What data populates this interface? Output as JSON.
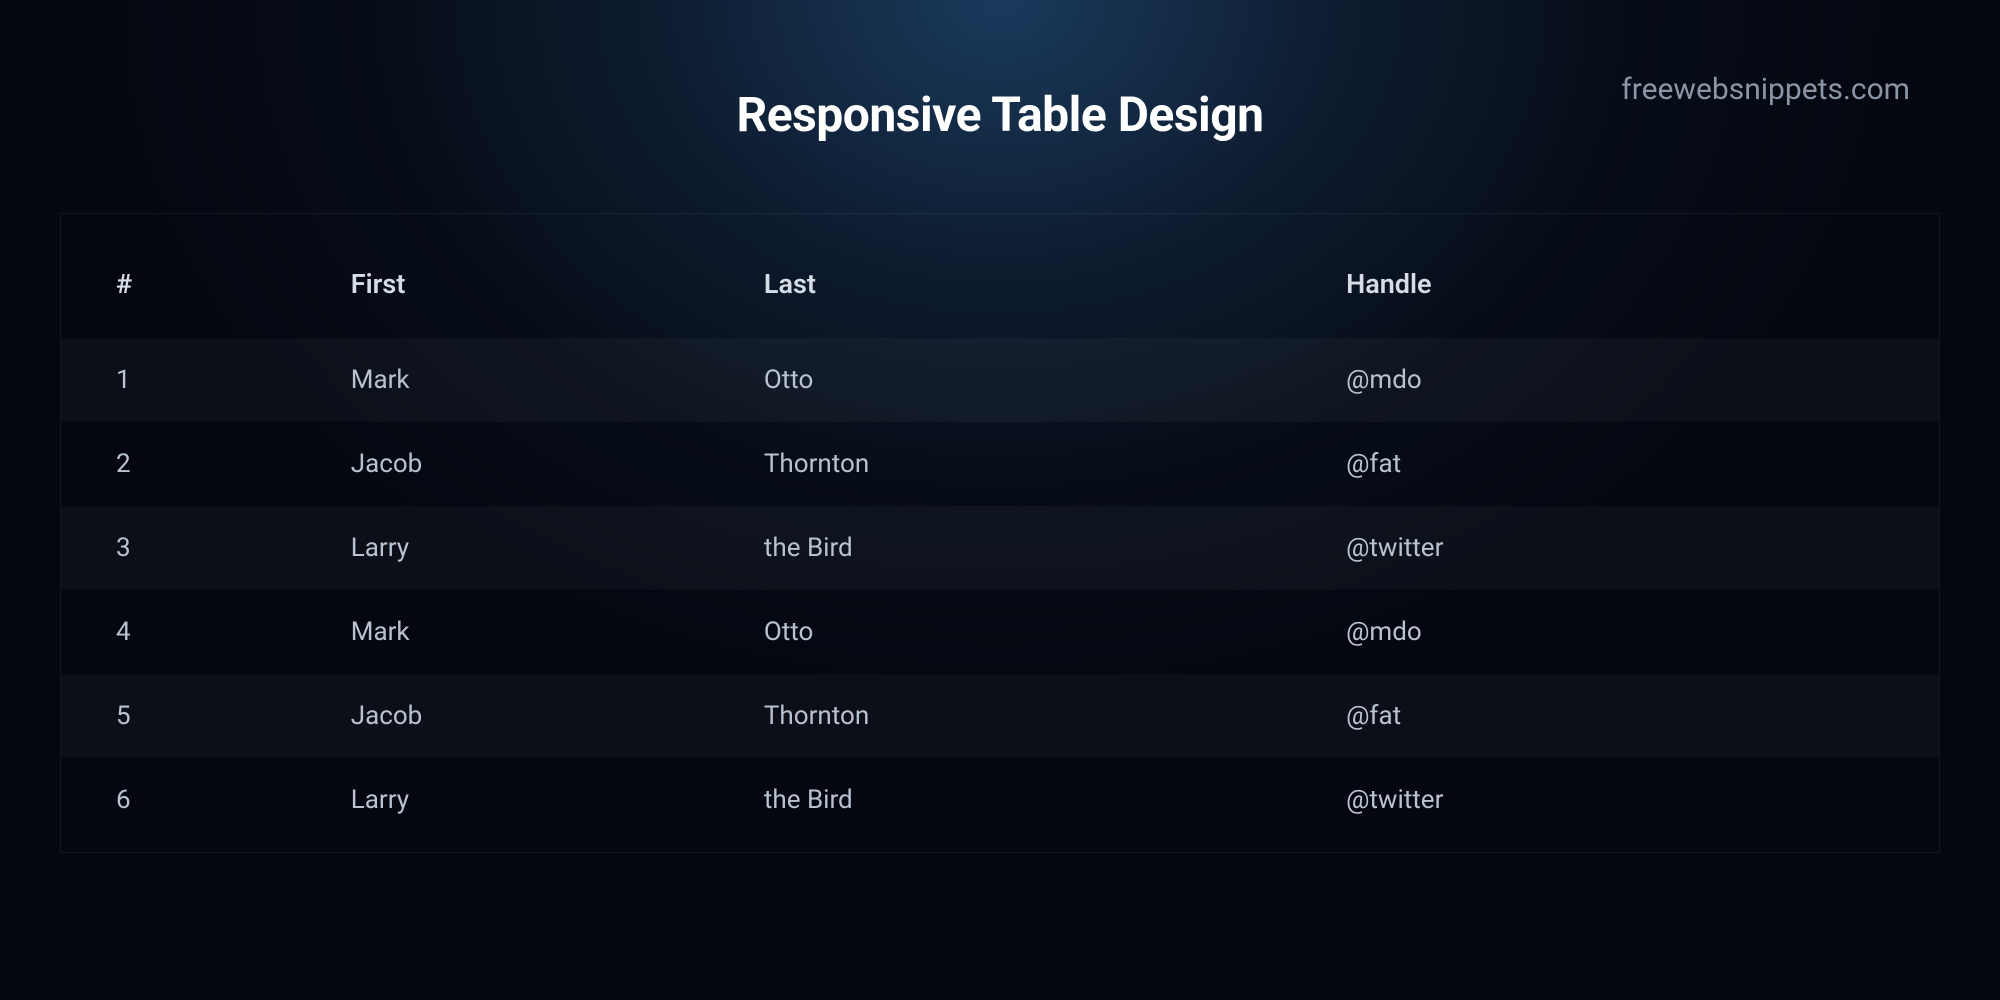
{
  "watermark": "freewebsnippets.com",
  "title": "Responsive Table Design",
  "table": {
    "headers": [
      "#",
      "First",
      "Last",
      "Handle"
    ],
    "rows": [
      {
        "num": "1",
        "first": "Mark",
        "last": "Otto",
        "handle": "@mdo"
      },
      {
        "num": "2",
        "first": "Jacob",
        "last": "Thornton",
        "handle": "@fat"
      },
      {
        "num": "3",
        "first": "Larry",
        "last": "the Bird",
        "handle": "@twitter"
      },
      {
        "num": "4",
        "first": "Mark",
        "last": "Otto",
        "handle": "@mdo"
      },
      {
        "num": "5",
        "first": "Jacob",
        "last": "Thornton",
        "handle": "@fat"
      },
      {
        "num": "6",
        "first": "Larry",
        "last": "the Bird",
        "handle": "@twitter"
      }
    ]
  }
}
